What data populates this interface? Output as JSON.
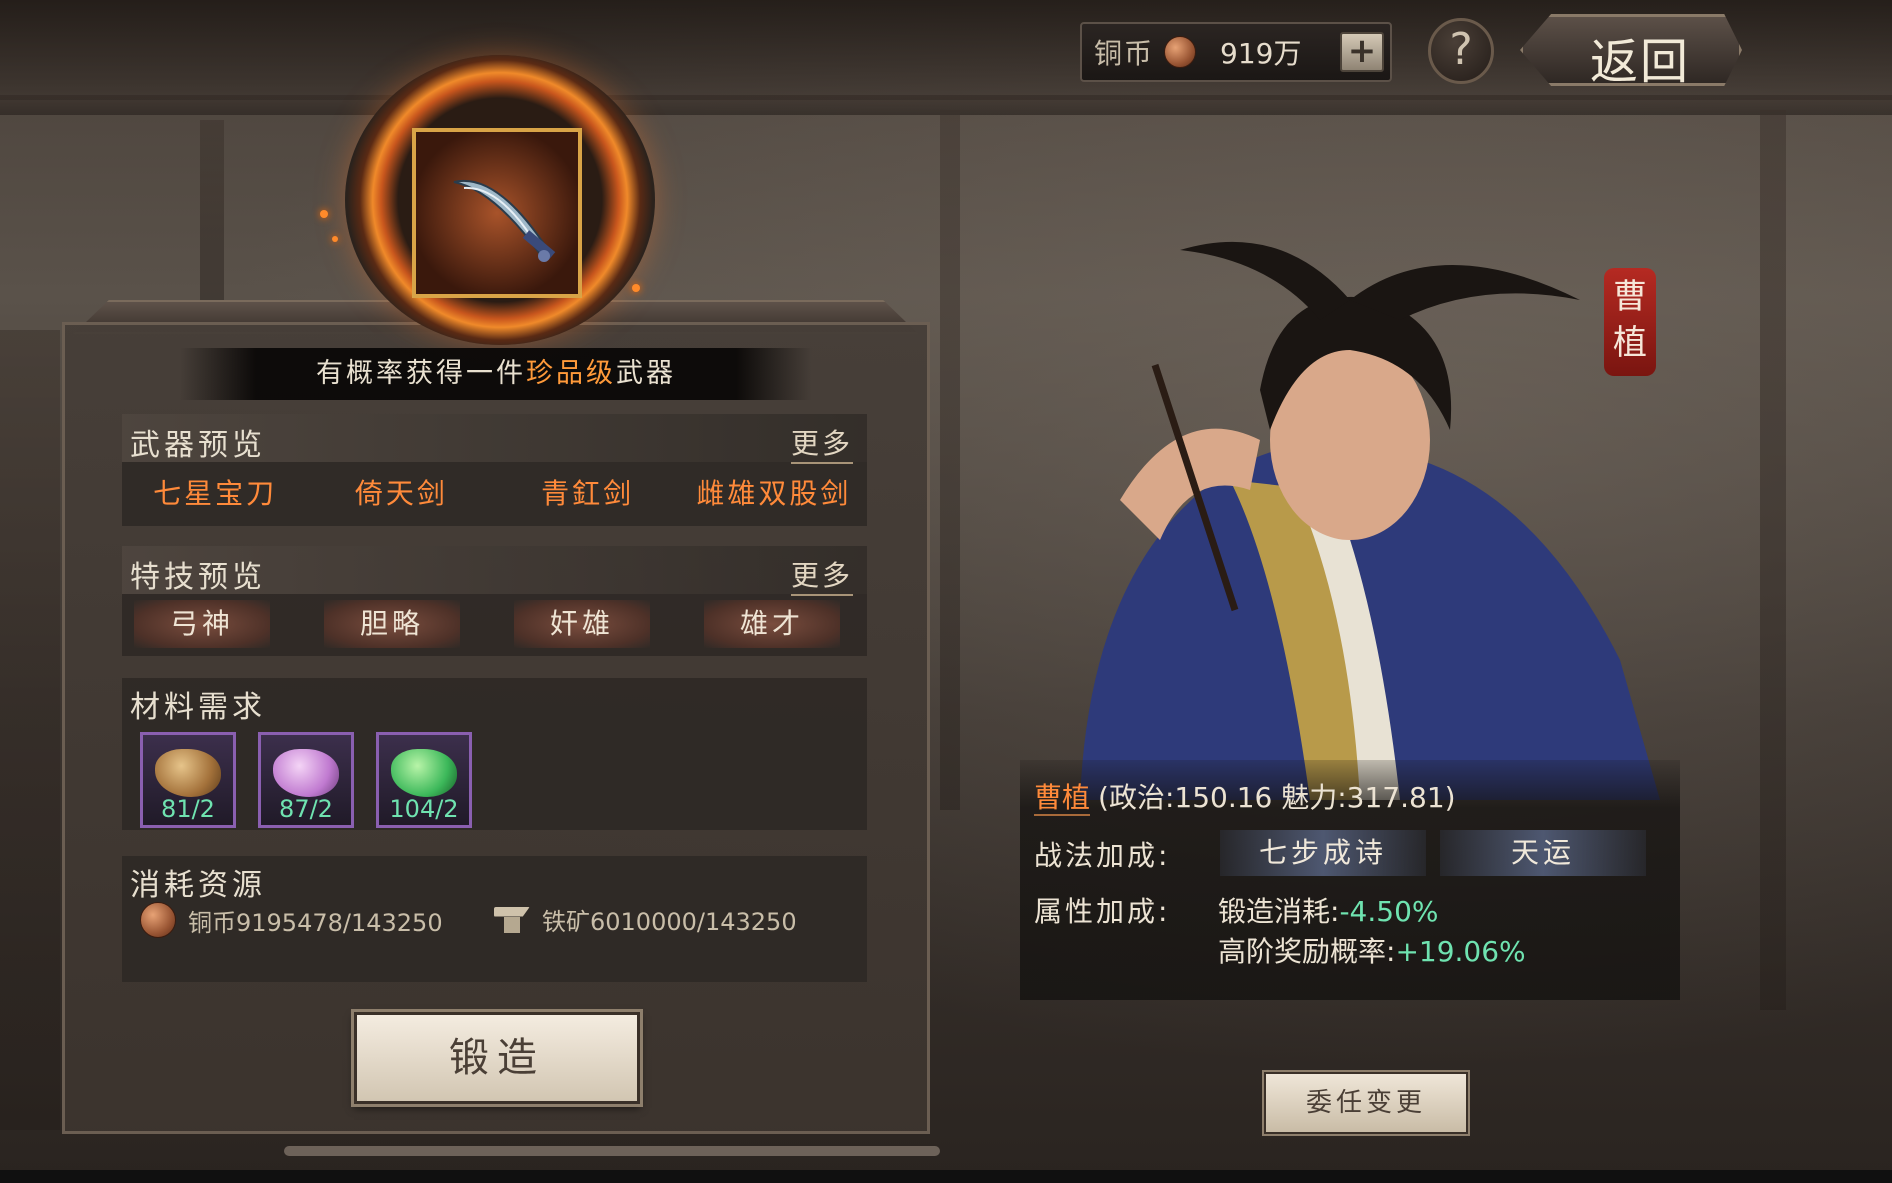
{
  "currency": {
    "label": "铜币",
    "amount": "919万",
    "add_label": "+"
  },
  "help_label": "?",
  "back_label": "返回",
  "banner": {
    "prefix": "有概率获得一件",
    "highlight": "珍品级",
    "suffix": "武器"
  },
  "weapon_preview": {
    "title": "武器预览",
    "more": "更多",
    "items": [
      "七星宝刀",
      "倚天剑",
      "青釭剑",
      "雌雄双股剑"
    ]
  },
  "skill_preview": {
    "title": "特技预览",
    "more": "更多",
    "items": [
      "弓神",
      "胆略",
      "奸雄",
      "雄才"
    ]
  },
  "materials": {
    "title": "材料需求",
    "items": [
      {
        "icon": "gold-ore-icon",
        "qty": "81/2",
        "color": "#c89a5a"
      },
      {
        "icon": "pink-crystal-icon",
        "qty": "87/2",
        "color": "#d59ad8"
      },
      {
        "icon": "jade-icon",
        "qty": "104/2",
        "color": "#4fcf6a"
      }
    ]
  },
  "resources": {
    "title": "消耗资源",
    "copper": "铜币9195478/143250",
    "iron": "铁矿6010000/143250"
  },
  "forge_label": "锻造",
  "general": {
    "seal": "曹植",
    "name": "曹植",
    "stats": "(政治:150.16 魅力:317.81)",
    "tactics_label": "战法加成:",
    "tactics": [
      "七步成诗",
      "天运"
    ],
    "attr_label": "属性加成:",
    "attr1_label": "锻造消耗:",
    "attr1_value": "-4.50%",
    "attr2_label": "高阶奖励概率:",
    "attr2_value": "+19.06%"
  },
  "appoint_label": "委任变更",
  "colors": {
    "accent_orange": "#ff8a3a",
    "bonus_green": "#6fe3b0",
    "seal_red": "#b52a22"
  }
}
